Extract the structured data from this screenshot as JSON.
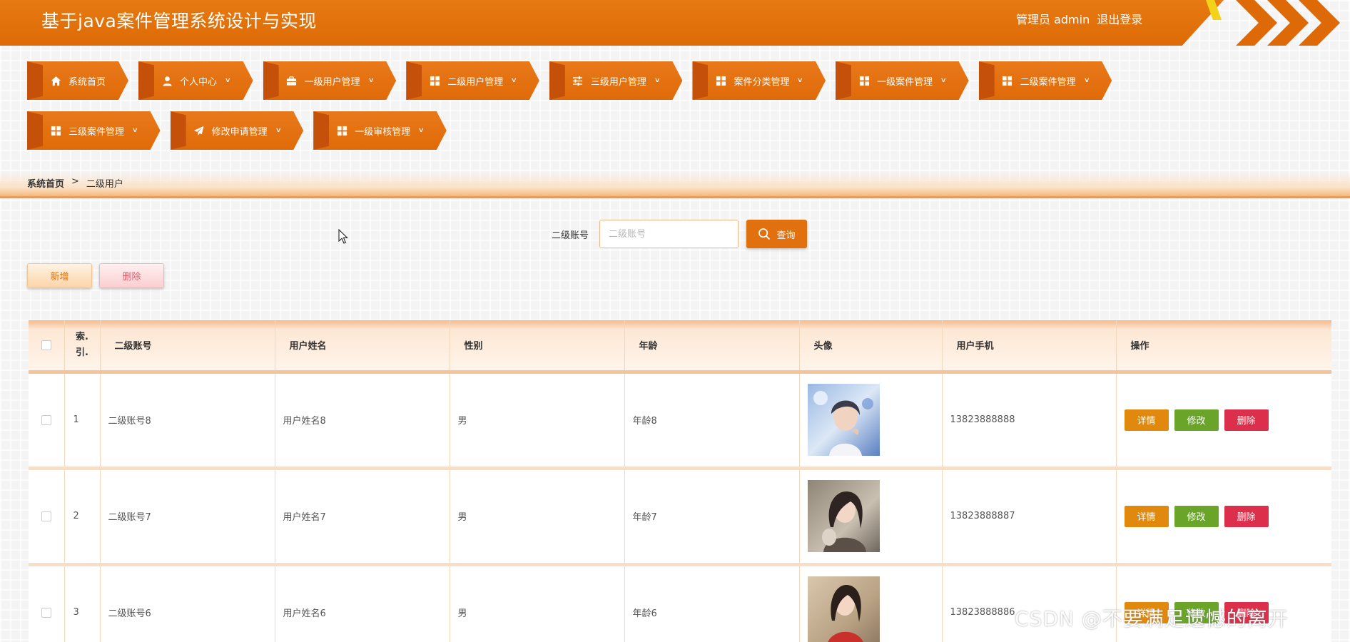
{
  "header": {
    "title": "基于java案件管理系统设计与实现",
    "user_label": "管理员 admin",
    "logout_label": "退出登录",
    "accent_color": "#dd6a06"
  },
  "nav": {
    "items": [
      {
        "label": "系统首页",
        "icon": "home-icon"
      },
      {
        "label": "个人中心",
        "icon": "user-icon"
      },
      {
        "label": "一级用户管理",
        "icon": "briefcase-icon"
      },
      {
        "label": "二级用户管理",
        "icon": "grid-icon"
      },
      {
        "label": "三级用户管理",
        "icon": "sliders-icon"
      },
      {
        "label": "案件分类管理",
        "icon": "grid-icon"
      },
      {
        "label": "一级案件管理",
        "icon": "grid-icon"
      },
      {
        "label": "二级案件管理",
        "icon": "grid-icon"
      },
      {
        "label": "三级案件管理",
        "icon": "grid-icon"
      },
      {
        "label": "修改申请管理",
        "icon": "send-icon"
      },
      {
        "label": "一级审核管理",
        "icon": "grid-icon"
      }
    ]
  },
  "breadcrumb": {
    "home": "系统首页",
    "separator": ">",
    "current": "二级用户"
  },
  "search": {
    "label": "二级账号",
    "placeholder": "二级账号",
    "value": "",
    "button_label": "查询"
  },
  "actions": {
    "add_label": "新增",
    "delete_label": "删除"
  },
  "table": {
    "columns": [
      "索.\n引.",
      "二级账号",
      "用户姓名",
      "性别",
      "年龄",
      "头像",
      "用户手机",
      "操作"
    ],
    "rows": [
      {
        "index": "1",
        "account": "二级账号8",
        "name": "用户姓名8",
        "gender": "男",
        "age": "年龄8",
        "phone": "13823888888"
      },
      {
        "index": "2",
        "account": "二级账号7",
        "name": "用户姓名7",
        "gender": "男",
        "age": "年龄7",
        "phone": "13823888887"
      },
      {
        "index": "3",
        "account": "二级账号6",
        "name": "用户姓名6",
        "gender": "男",
        "age": "年龄6",
        "phone": "13823888886"
      }
    ],
    "row_actions": {
      "detail": "详情",
      "edit": "修改",
      "delete": "删除"
    }
  },
  "watermark": "CSDN @不要满足遗憾的离开"
}
